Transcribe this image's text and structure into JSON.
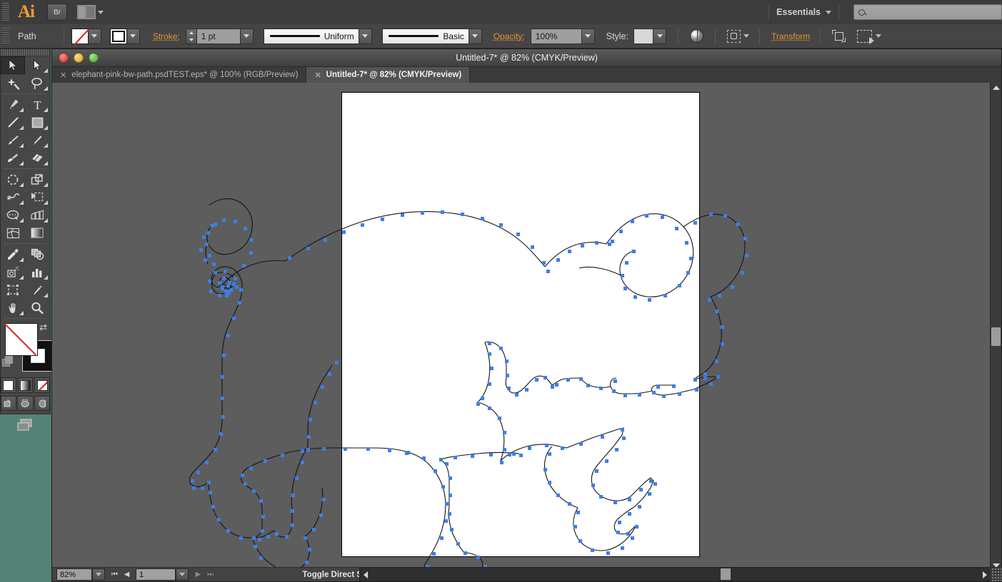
{
  "app": {
    "name": "Adobe Illustrator",
    "logo_text": "Ai",
    "bridge_label": "Br",
    "arrange_icon": "arrange-documents-icon",
    "workspace_label": "Essentials",
    "search_placeholder": "",
    "search_icon": "search-icon"
  },
  "control_bar": {
    "selection_label": "Path",
    "fill_swatch_icon": "fill-none-swatch",
    "stroke_swatch_icon": "stroke-swatch",
    "stroke_label": "Stroke:",
    "stroke_weight": "1 pt",
    "variable_width_profile": "Uniform",
    "brush_definition": "Basic",
    "opacity_label": "Opacity:",
    "opacity_value": "100%",
    "style_label": "Style:",
    "style_swatch_icon": "graphic-style-swatch",
    "recolor_icon": "recolor-artwork-icon",
    "select_similar_icon": "select-similar-objects-icon",
    "transform_label": "Transform",
    "align_icon": "align-icon",
    "shape_icon": "shape-options-icon",
    "accent_orange": "#e79434"
  },
  "document_window": {
    "title": "Untitled-7* @ 82% (CMYK/Preview)",
    "traffic_lights": [
      "close",
      "minimize",
      "zoom"
    ],
    "tabs": [
      {
        "label": "elephant-pink-bw-path.psdTEST.eps* @ 100% (RGB/Preview)",
        "active": false,
        "close_icon": "close-tab-icon"
      },
      {
        "label": "Untitled-7* @ 82% (CMYK/Preview)",
        "active": true,
        "close_icon": "close-tab-icon"
      }
    ]
  },
  "canvas": {
    "background_color": "#5d5d5d",
    "artboard_color": "#ffffff",
    "path_stroke_color": "#111111",
    "anchor_point_color": "#3d7fe8",
    "artwork_description": "elephant outline path with anchor points"
  },
  "status_bar": {
    "zoom_level": "82%",
    "first_page_icon": "first-page-icon",
    "prev_page_icon": "previous-page-icon",
    "page_number": "1",
    "next_page_icon": "next-page-icon",
    "last_page_icon": "last-page-icon",
    "status_text": "Toggle Direct Selection",
    "status_menu_icon": "status-menu-icon"
  },
  "tools": {
    "rows": [
      [
        {
          "name": "selection-tool",
          "selected": true
        },
        {
          "name": "direct-selection-tool",
          "selected": false
        }
      ],
      [
        {
          "name": "magic-wand-tool",
          "selected": false
        },
        {
          "name": "lasso-tool",
          "selected": false
        }
      ],
      [
        {
          "name": "pen-tool",
          "selected": false
        },
        {
          "name": "type-tool",
          "selected": false
        }
      ],
      [
        {
          "name": "line-segment-tool",
          "selected": false
        },
        {
          "name": "rectangle-tool",
          "selected": false
        }
      ],
      [
        {
          "name": "paintbrush-tool",
          "selected": false
        },
        {
          "name": "pencil-tool",
          "selected": false
        }
      ],
      [
        {
          "name": "blob-brush-tool",
          "selected": false
        },
        {
          "name": "eraser-tool",
          "selected": false
        }
      ],
      [
        {
          "name": "rotate-tool",
          "selected": false
        },
        {
          "name": "scale-tool",
          "selected": false
        }
      ],
      [
        {
          "name": "width-tool",
          "selected": false
        },
        {
          "name": "free-transform-tool",
          "selected": false
        }
      ],
      [
        {
          "name": "shape-builder-tool",
          "selected": false
        },
        {
          "name": "perspective-grid-tool",
          "selected": false
        }
      ],
      [
        {
          "name": "mesh-tool",
          "selected": false
        },
        {
          "name": "gradient-tool",
          "selected": false
        }
      ],
      [
        {
          "name": "eyedropper-tool",
          "selected": false
        },
        {
          "name": "blend-tool",
          "selected": false
        }
      ],
      [
        {
          "name": "symbol-sprayer-tool",
          "selected": false
        },
        {
          "name": "column-graph-tool",
          "selected": false
        }
      ],
      [
        {
          "name": "artboard-tool",
          "selected": false
        },
        {
          "name": "slice-tool",
          "selected": false
        }
      ],
      [
        {
          "name": "hand-tool",
          "selected": false
        },
        {
          "name": "zoom-tool",
          "selected": false
        }
      ]
    ],
    "fill_stroke": {
      "fill_name": "fill-none",
      "stroke_name": "stroke-black",
      "swap_icon": "swap-fill-stroke-icon",
      "default_icon": "default-fill-stroke-icon"
    },
    "color_modes": [
      {
        "name": "color-mode-button"
      },
      {
        "name": "gradient-mode-button"
      },
      {
        "name": "none-mode-button"
      }
    ],
    "draw_modes": [
      {
        "name": "draw-normal-button"
      },
      {
        "name": "draw-behind-button"
      },
      {
        "name": "draw-inside-button"
      }
    ],
    "screen_mode": {
      "name": "change-screen-mode-button"
    }
  }
}
